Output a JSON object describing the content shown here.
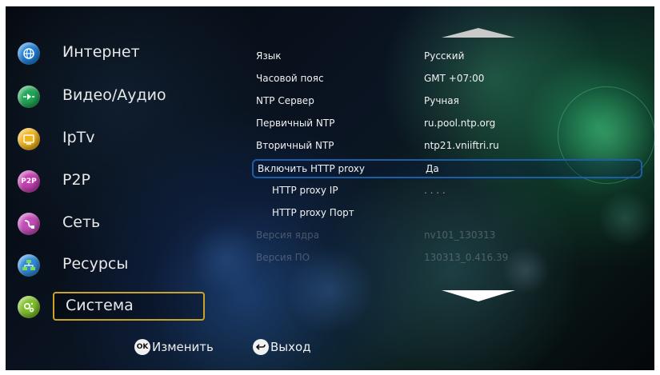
{
  "menu": {
    "items": [
      {
        "label": "Интернет",
        "icon": "globe-icon",
        "color": "#1e7fd6"
      },
      {
        "label": "Видео/Аудио",
        "icon": "play-icon",
        "color": "#22a556"
      },
      {
        "label": "IpTv",
        "icon": "tv-icon",
        "color": "#f0b41a"
      },
      {
        "label": "P2P",
        "icon": "p2p-icon",
        "color": "#c43fb0"
      },
      {
        "label": "Сеть",
        "icon": "network-cable-icon",
        "color": "#c24cb8"
      },
      {
        "label": "Ресурсы",
        "icon": "resources-icon",
        "color": "#2f8ad8"
      },
      {
        "label": "Система",
        "icon": "gears-icon",
        "color": "#7dbf2a"
      }
    ],
    "selected": "Система",
    "p2p_icon_text": "P2P"
  },
  "settings": {
    "rows": [
      {
        "label": "Язык",
        "value": "Русский"
      },
      {
        "label": "Часовой пояс",
        "value": "GMT +07:00"
      },
      {
        "label": "NTP Сервер",
        "value": "Ручная"
      },
      {
        "label": "Первичный NTP",
        "value": "ru.pool.ntp.org"
      },
      {
        "label": "Вторичный NTP",
        "value": "ntp21.vniiftri.ru"
      },
      {
        "label": "Включить HTTP proxy",
        "value": "Да"
      },
      {
        "label": "HTTP proxy IP",
        "value": ". . . ."
      },
      {
        "label": "HTTP proxy Порт",
        "value": ""
      },
      {
        "label": "Версия ядра",
        "value": "nv101_130313"
      },
      {
        "label": "Версия ПО",
        "value": "130313_0.416.39"
      }
    ],
    "highlighted": "Включить HTTP proxy"
  },
  "footer": {
    "ok_icon_text": "OK",
    "ok_label": "Изменить",
    "back_label": "Выход"
  },
  "colors": {
    "selection_border": "#c9a227",
    "highlight_border": "#1c5ea8"
  }
}
